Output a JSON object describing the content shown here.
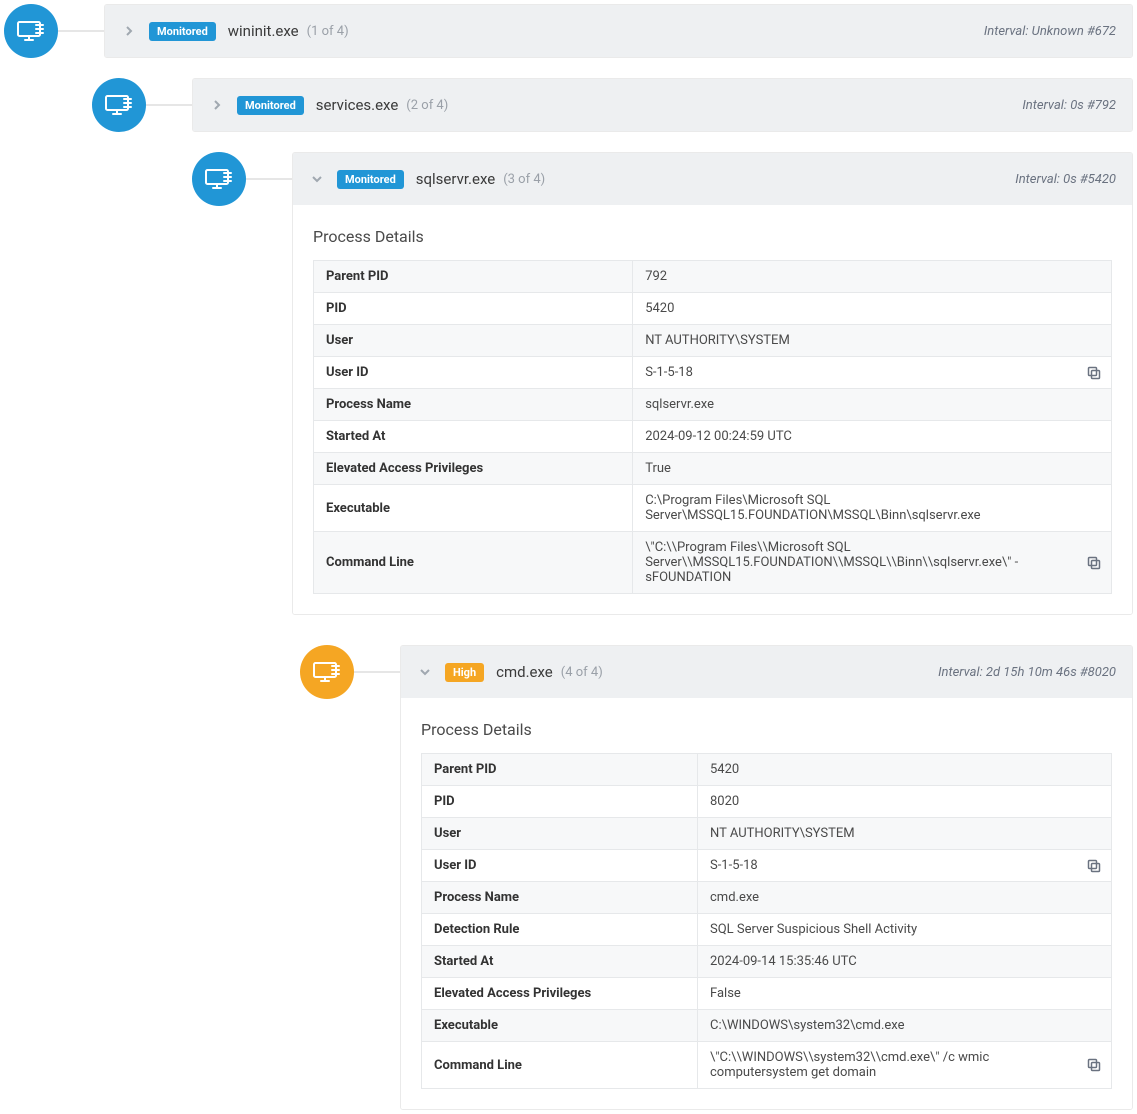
{
  "labels": {
    "process_details": "Process Details",
    "interval_prefix": "Interval: "
  },
  "fields": {
    "parent_pid": "Parent PID",
    "pid": "PID",
    "user": "User",
    "user_id": "User ID",
    "process_name": "Process Name",
    "detection_rule": "Detection Rule",
    "started_at": "Started At",
    "elevated": "Elevated Access Privileges",
    "executable": "Executable",
    "command_line": "Command Line"
  },
  "badges": {
    "monitored": "Monitored",
    "high": "High"
  },
  "node0": {
    "name": "wininit.exe",
    "count": "(1 of 4)",
    "interval": "Unknown #672"
  },
  "node1": {
    "name": "services.exe",
    "count": "(2 of 4)",
    "interval": "0s #792"
  },
  "node2": {
    "name": "sqlservr.exe",
    "count": "(3 of 4)",
    "interval": "0s #5420",
    "details": {
      "parent_pid": "792",
      "pid": "5420",
      "user": "NT AUTHORITY\\SYSTEM",
      "user_id": "S-1-5-18",
      "process_name": "sqlservr.exe",
      "started_at": "2024-09-12 00:24:59 UTC",
      "elevated": "True",
      "executable": "C:\\Program Files\\Microsoft SQL Server\\MSSQL15.FOUNDATION\\MSSQL\\Binn\\sqlservr.exe",
      "command_line": "\\\"C:\\\\Program Files\\\\Microsoft SQL Server\\\\MSSQL15.FOUNDATION\\\\MSSQL\\\\Binn\\\\sqlservr.exe\\\" -sFOUNDATION"
    }
  },
  "node3": {
    "name": "cmd.exe",
    "count": "(4 of 4)",
    "interval": "2d 15h 10m 46s #8020",
    "details": {
      "parent_pid": "5420",
      "pid": "8020",
      "user": "NT AUTHORITY\\SYSTEM",
      "user_id": "S-1-5-18",
      "process_name": "cmd.exe",
      "detection_rule": "SQL Server Suspicious Shell Activity",
      "started_at": "2024-09-14 15:35:46 UTC",
      "elevated": "False",
      "executable": "C:\\WINDOWS\\system32\\cmd.exe",
      "command_line": "\\\"C:\\\\WINDOWS\\\\system32\\\\cmd.exe\\\" /c wmic computersystem get domain"
    }
  }
}
